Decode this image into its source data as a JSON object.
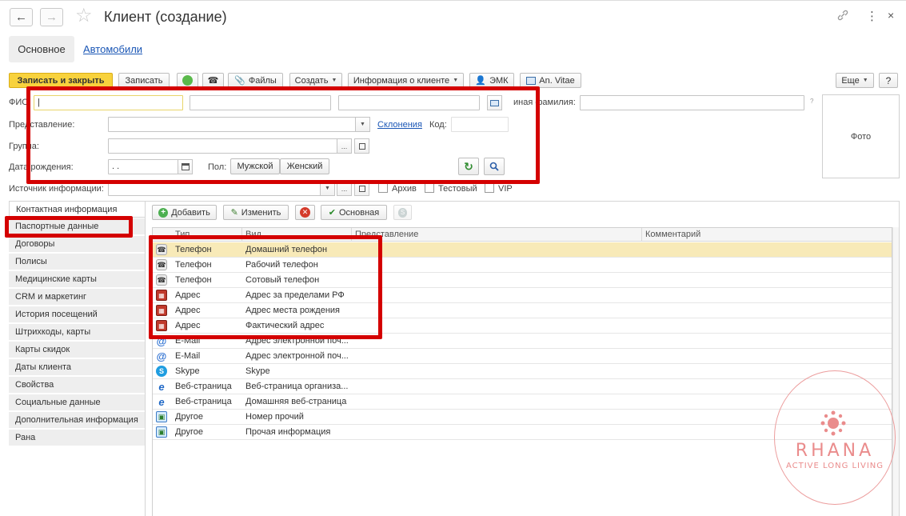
{
  "window": {
    "title": "Клиент (создание)",
    "back_glyph": "←",
    "forward_glyph": "→",
    "star_glyph": "☆",
    "link_glyph": "🔗",
    "more_glyph": "⋮",
    "close_glyph": "×"
  },
  "tabs": [
    {
      "label": "Основное",
      "active": true
    },
    {
      "label": "Автомобили",
      "active": false
    }
  ],
  "toolbar": {
    "save_close": "Записать и закрыть",
    "save": "Записать",
    "files": "Файлы",
    "create": "Создать",
    "client_info": "Информация о клиенте",
    "emk": "ЭМК",
    "an_vitae": "An. Vitae",
    "more": "Еще",
    "help": "?"
  },
  "form": {
    "fio_label": "ФИО:",
    "fio_value": "|",
    "other_surname_label": "иная фамилия:",
    "presentation_label": "Представление:",
    "declension_link": "Склонения",
    "code_label": "Код:",
    "group_label": "Группа:",
    "birthdate_label": "Дата рождения:",
    "birthdate_value": " .  .",
    "gender_label": "Пол:",
    "gender_male": "Мужской",
    "gender_female": "Женский",
    "source_label": "Источник информации:",
    "archive_label": "Архив",
    "test_label": "Тестовый",
    "vip_label": "VIP",
    "photo_label": "Фото",
    "dots": "...",
    "question": "?"
  },
  "sidebar": {
    "items": [
      {
        "label": "Контактная информация",
        "active": true
      },
      {
        "label": "Паспортные данные",
        "active": false
      },
      {
        "label": "Договоры",
        "active": false
      },
      {
        "label": "Полисы",
        "active": false
      },
      {
        "label": "Медицинские карты",
        "active": false
      },
      {
        "label": "CRM и маркетинг",
        "active": false
      },
      {
        "label": "История посещений",
        "active": false
      },
      {
        "label": "Штрихкоды, карты",
        "active": false
      },
      {
        "label": "Карты скидок",
        "active": false
      },
      {
        "label": "Даты клиента",
        "active": false
      },
      {
        "label": "Свойства",
        "active": false
      },
      {
        "label": "Социальные данные",
        "active": false
      },
      {
        "label": "Дополнительная информация",
        "active": false
      },
      {
        "label": "Рана",
        "active": false
      }
    ]
  },
  "contacts_toolbar": {
    "add": "Добавить",
    "edit": "Изменить",
    "main": "Основная"
  },
  "contacts_table": {
    "columns": [
      "Тип",
      "Вид",
      "Представление",
      "Комментарий"
    ],
    "rows": [
      {
        "icon": "phone",
        "type": "Телефон",
        "kind": "Домашний телефон"
      },
      {
        "icon": "phone",
        "type": "Телефон",
        "kind": "Рабочий телефон"
      },
      {
        "icon": "phone",
        "type": "Телефон",
        "kind": "Сотовый телефон"
      },
      {
        "icon": "addr",
        "type": "Адрес",
        "kind": "Адрес за пределами РФ"
      },
      {
        "icon": "addr",
        "type": "Адрес",
        "kind": "Адрес места рождения"
      },
      {
        "icon": "addr",
        "type": "Адрес",
        "kind": "Фактический адрес"
      },
      {
        "icon": "mail",
        "type": "E-Mail",
        "kind": "Адрес электронной поч..."
      },
      {
        "icon": "mail",
        "type": "E-Mail",
        "kind": "Адрес электронной поч..."
      },
      {
        "icon": "skype",
        "type": "Skype",
        "kind": "Skype"
      },
      {
        "icon": "web",
        "type": "Веб-страница",
        "kind": "Веб-страница организа..."
      },
      {
        "icon": "web",
        "type": "Веб-страница",
        "kind": "Домашняя веб-страница"
      },
      {
        "icon": "other",
        "type": "Другое",
        "kind": "Номер прочий"
      },
      {
        "icon": "other",
        "type": "Другое",
        "kind": "Прочая информация"
      }
    ]
  },
  "watermark": {
    "name": "RHANA",
    "tagline": "ACTIVE LONG LIVING"
  },
  "colors": {
    "accent_yellow": "#f8d23d",
    "selected_row": "#f8eab8",
    "highlight_red": "#d40000",
    "link_blue": "#1a56b5"
  }
}
